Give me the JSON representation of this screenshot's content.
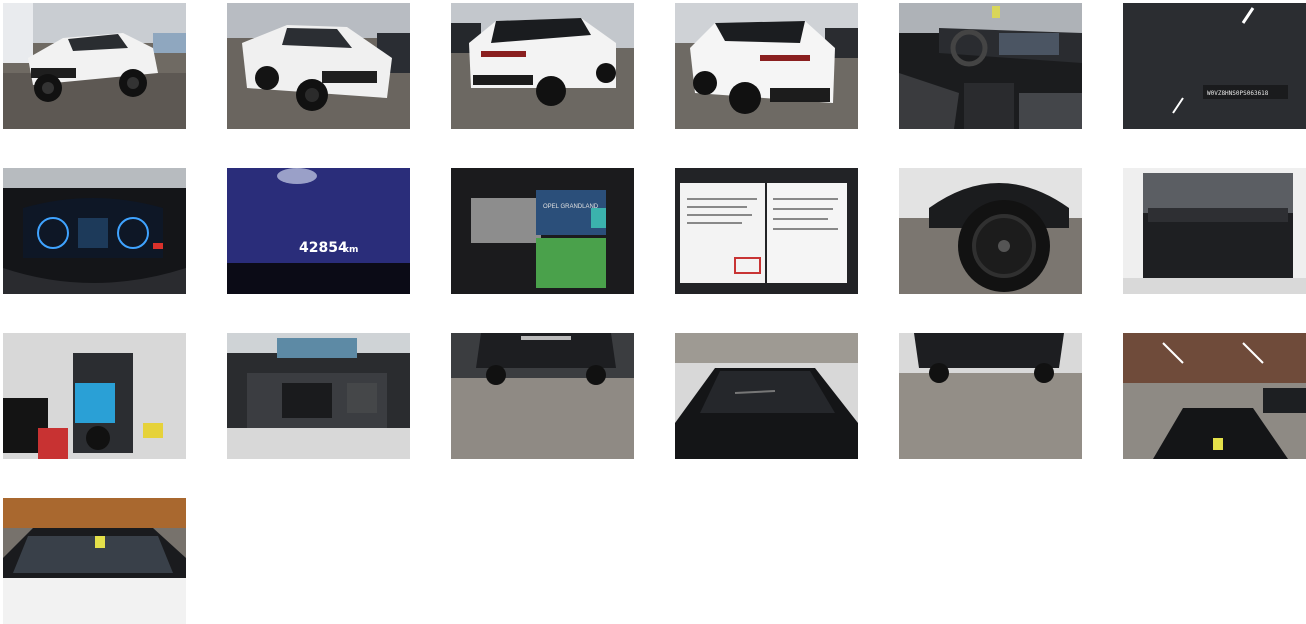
{
  "gallery": {
    "photos": [
      {
        "subject": "front-left-exterior"
      },
      {
        "subject": "front-right-exterior"
      },
      {
        "subject": "rear-left-exterior"
      },
      {
        "subject": "rear-right-exterior"
      },
      {
        "subject": "interior-dashboard"
      },
      {
        "subject": "windshield-vin-plate"
      },
      {
        "subject": "instrument-cluster"
      },
      {
        "subject": "odometer"
      },
      {
        "subject": "manuals-and-keys"
      },
      {
        "subject": "service-book"
      },
      {
        "subject": "wheel"
      },
      {
        "subject": "trunk"
      },
      {
        "subject": "spare-tire-well"
      },
      {
        "subject": "engine-bay"
      },
      {
        "subject": "rear-underside"
      },
      {
        "subject": "roof"
      },
      {
        "subject": "front-underside"
      },
      {
        "subject": "hall-overview"
      },
      {
        "subject": "hood-and-windshield"
      }
    ],
    "odometer": {
      "value": "42854",
      "unit": "km"
    },
    "vin_plate_text": "W0VZ8HNS0PS063618",
    "manual_title": "OPEL GRANDLAND"
  }
}
